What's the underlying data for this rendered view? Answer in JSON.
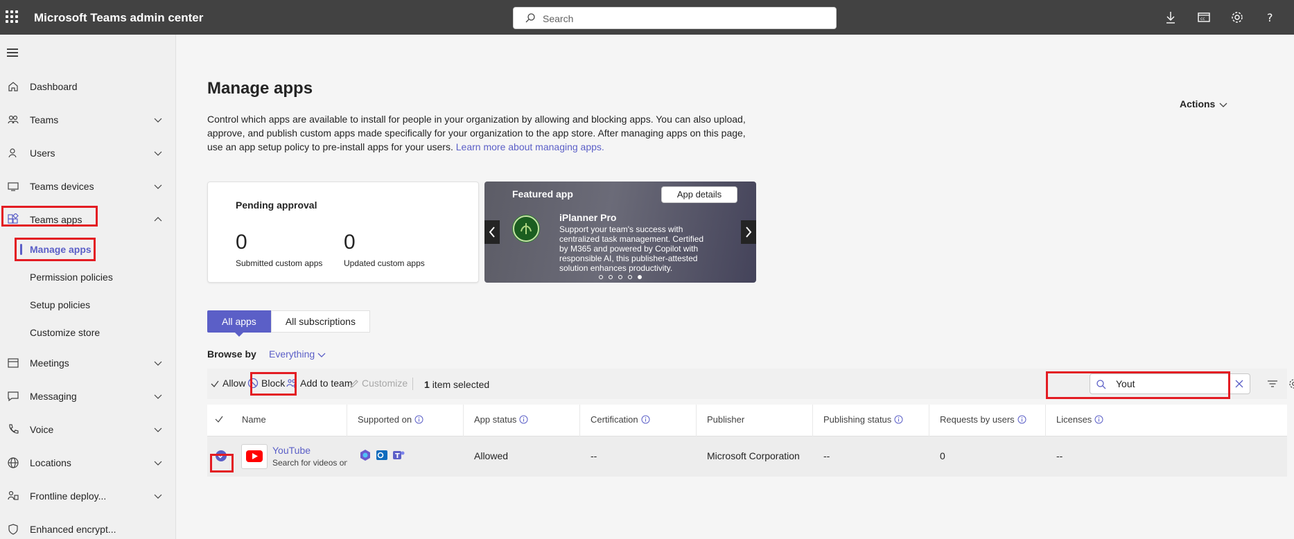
{
  "topbar": {
    "title": "Microsoft Teams admin center",
    "search_placeholder": "Search",
    "icons": [
      "download-icon",
      "display-icon",
      "gear-icon",
      "help-icon"
    ]
  },
  "sidebar": {
    "items": [
      {
        "label": "Dashboard",
        "icon": "home-icon"
      },
      {
        "label": "Teams",
        "icon": "people-team-icon"
      },
      {
        "label": "Users",
        "icon": "person-icon"
      },
      {
        "label": "Teams devices",
        "icon": "device-icon"
      },
      {
        "label": "Teams apps",
        "icon": "apps-icon"
      },
      {
        "label": "Meetings",
        "icon": "calendar-icon"
      },
      {
        "label": "Messaging",
        "icon": "chat-icon"
      },
      {
        "label": "Voice",
        "icon": "phone-icon"
      },
      {
        "label": "Locations",
        "icon": "globe-icon"
      },
      {
        "label": "Frontline deploy...",
        "icon": "frontline-icon"
      },
      {
        "label": "Enhanced encrypt...",
        "icon": "shield-icon"
      }
    ],
    "sub_items": [
      {
        "label": "Manage apps",
        "active": true
      },
      {
        "label": "Permission policies"
      },
      {
        "label": "Setup policies"
      },
      {
        "label": "Customize store"
      }
    ]
  },
  "main": {
    "title": "Manage apps",
    "actions_label": "Actions",
    "description": "Control which apps are available to install for people in your organization by allowing and blocking apps. You can also upload, approve, and publish custom apps made specifically for your organization to the app store. After managing apps on this page, use an app setup policy to pre-install apps for your users.",
    "learn_more": "Learn more about managing apps.",
    "pending": {
      "title": "Pending approval",
      "submitted_count": "0",
      "submitted_label": "Submitted custom apps",
      "updated_count": "0",
      "updated_label": "Updated custom apps"
    },
    "featured": {
      "title": "Featured app",
      "details_button": "App details",
      "app_name": "iPlanner Pro",
      "app_desc": "Support your team's success with centralized task management. Certified by M365 and powered by Copilot with responsible AI, this publisher-attested solution enhances productivity."
    },
    "tabs": [
      "All apps",
      "All subscriptions"
    ],
    "browse_by_label": "Browse by",
    "browse_by_value": "Everything",
    "toolbar": {
      "allow": "Allow",
      "block": "Block",
      "add_to_team": "Add to team",
      "customize": "Customize",
      "selected_count": "1",
      "selected_text": "item selected",
      "search_value": "Yout"
    },
    "table": {
      "columns": [
        "Name",
        "Supported on",
        "App status",
        "Certification",
        "Publisher",
        "Publishing status",
        "Requests by users",
        "Licenses"
      ],
      "rows": [
        {
          "name": "YouTube",
          "description": "Search for videos on YouTube",
          "app_status": "Allowed",
          "certification": "--",
          "publisher": "Microsoft Corporation",
          "publishing_status": "--",
          "requests": "0",
          "licenses": "--"
        }
      ]
    }
  },
  "colors": {
    "topbar": "#424242",
    "accent": "#5b5fc7",
    "highlight": "#e31c23"
  }
}
